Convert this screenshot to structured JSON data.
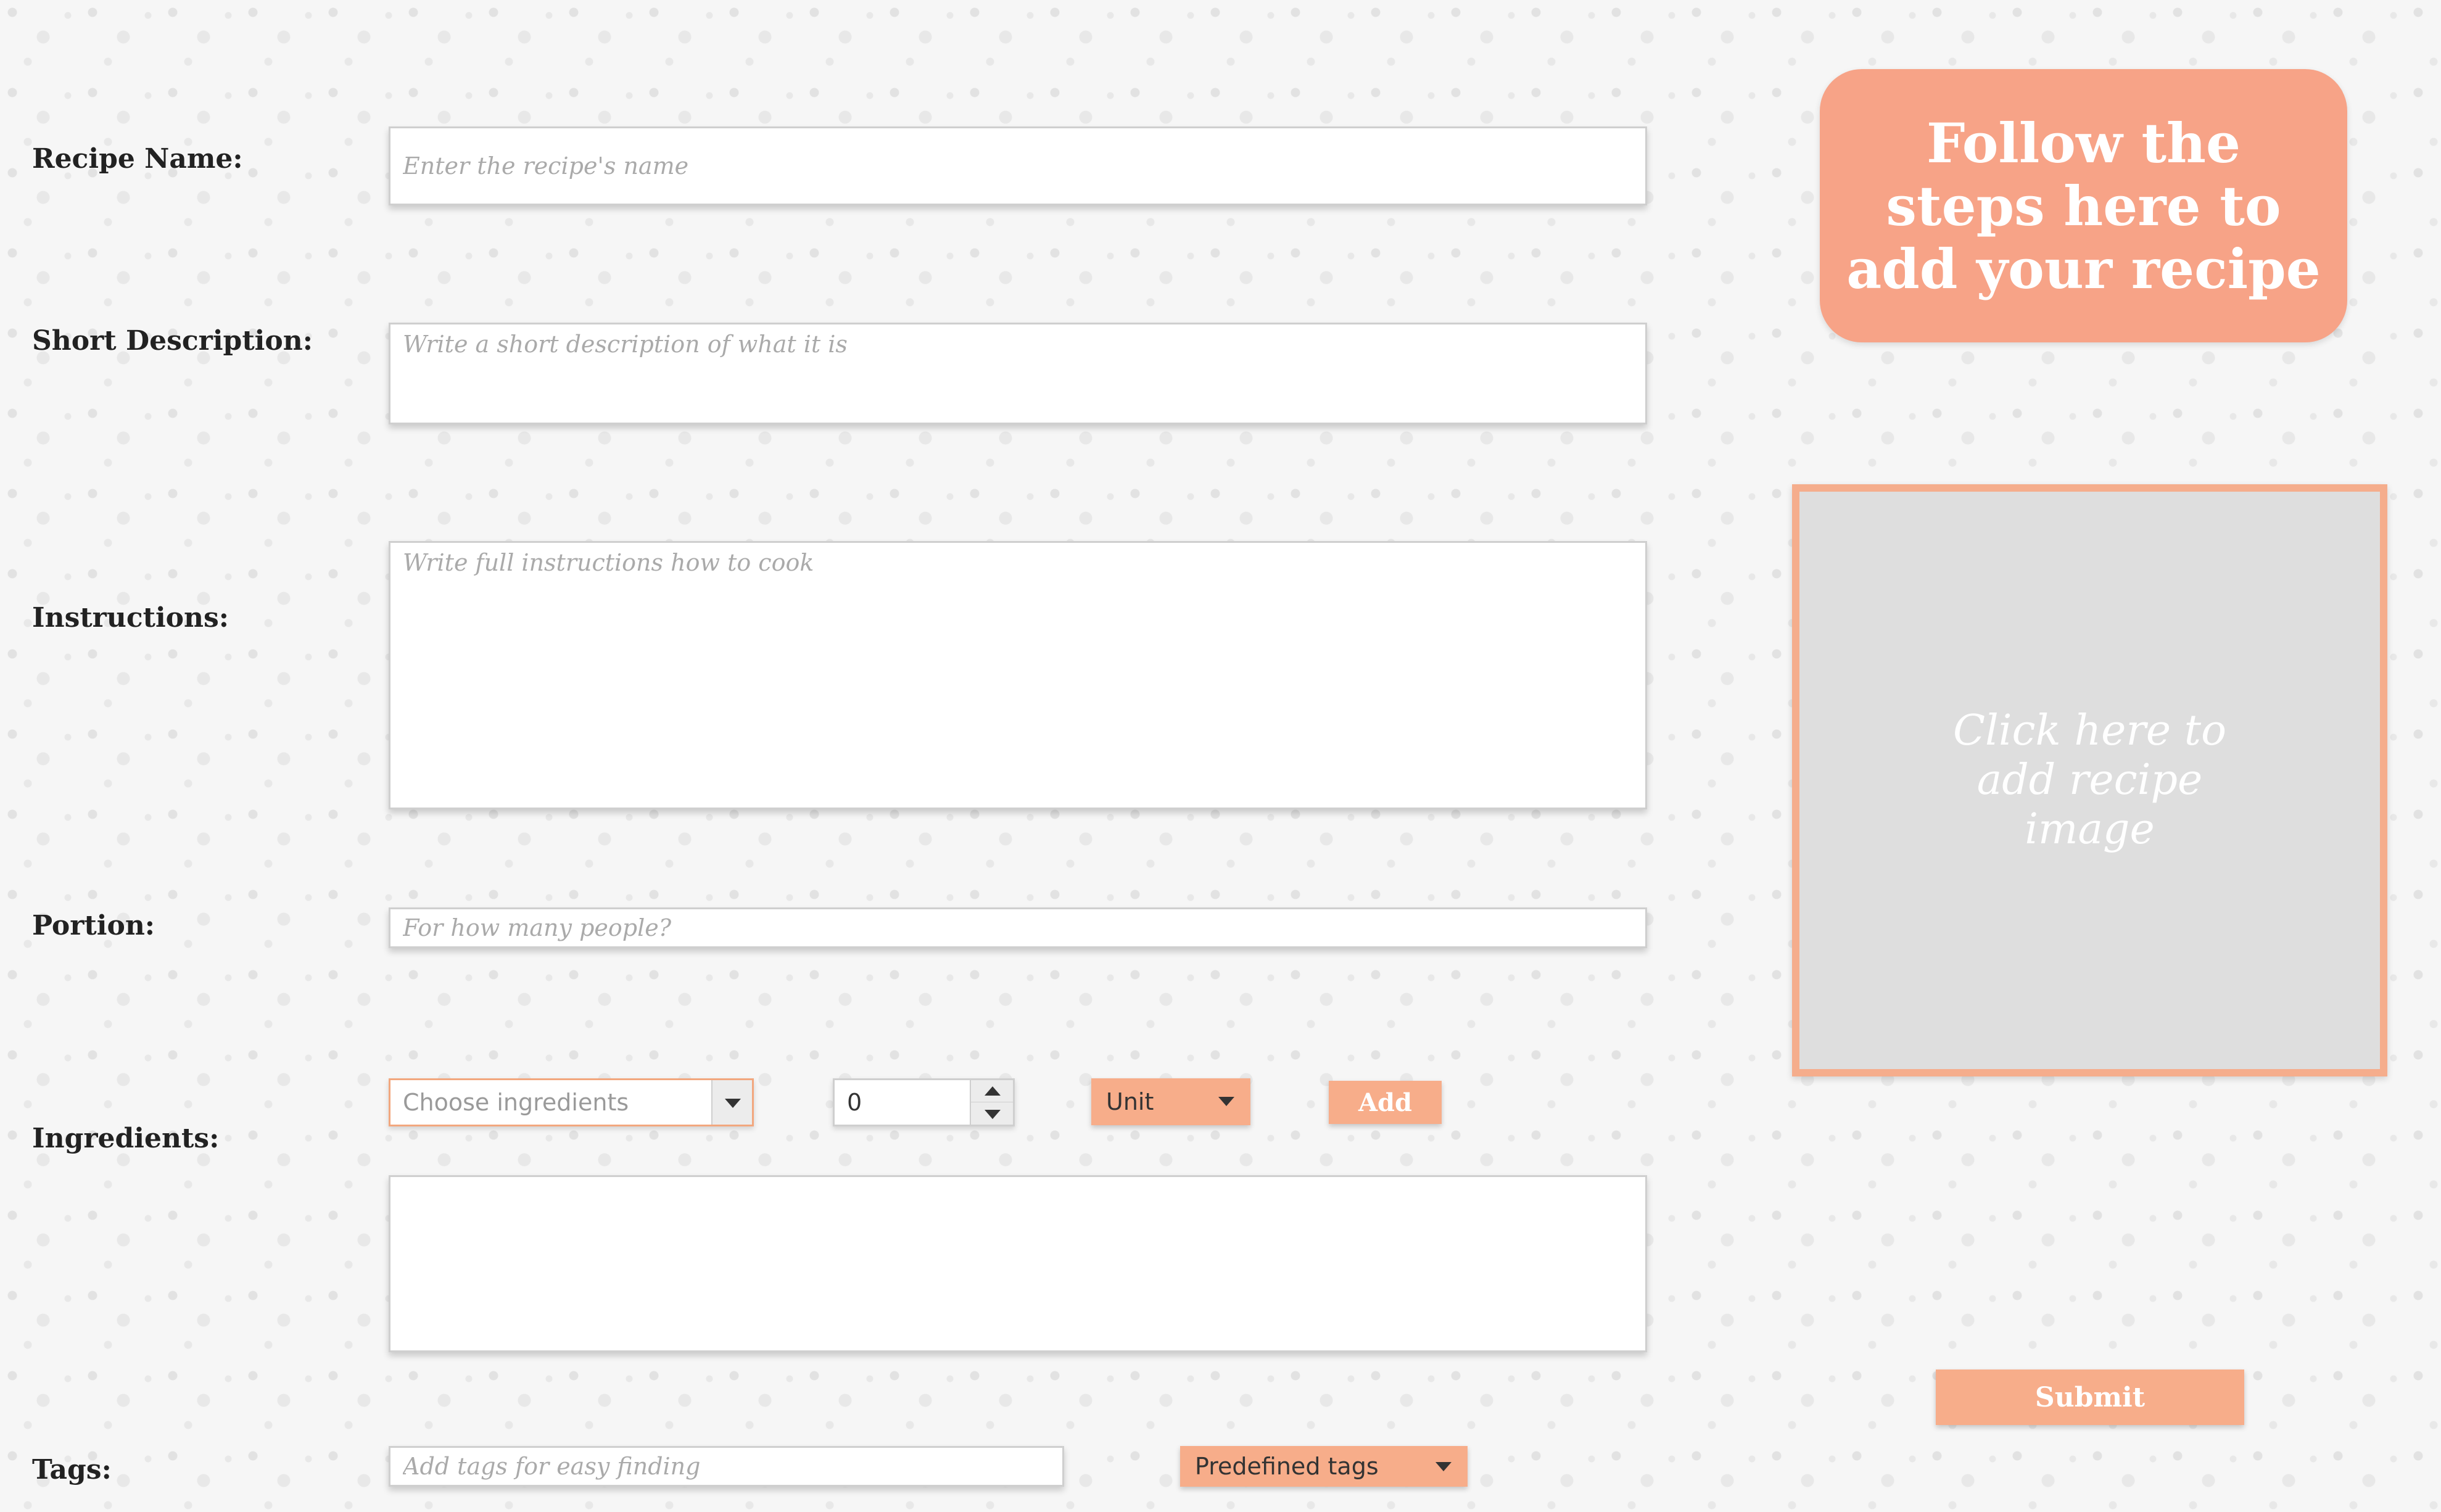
{
  "form": {
    "recipe_name": {
      "label": "Recipe Name:",
      "value": "",
      "placeholder": "Enter the recipe's name"
    },
    "short_description": {
      "label": "Short Description:",
      "value": "",
      "placeholder": "Write a short description of what it is"
    },
    "instructions": {
      "label": "Instructions:",
      "value": "",
      "placeholder": "Write full instructions how to cook"
    },
    "portion": {
      "label": "Portion:",
      "value": "",
      "placeholder": "For how many people?"
    },
    "ingredients": {
      "label": "Ingredients:",
      "select_placeholder": "Choose ingredients",
      "quantity_value": "0",
      "unit_label": "Unit",
      "add_label": "Add",
      "list_value": ""
    },
    "tags": {
      "label": "Tags:",
      "value": "",
      "placeholder": "Add tags for easy finding",
      "predefined_label": "Predefined tags"
    }
  },
  "sidebar": {
    "banner_text": "Follow the steps here to add your recipe",
    "image_prompt": "Click here to add recipe image",
    "submit_label": "Submit"
  },
  "colors": {
    "accent": "#f7ad8a",
    "banner": "#f7a387",
    "image_placeholder_bg": "#dedede"
  },
  "icons": {
    "dropdown": "chevron-down-icon",
    "stepper_up": "chevron-up-icon",
    "stepper_down": "chevron-down-icon"
  }
}
